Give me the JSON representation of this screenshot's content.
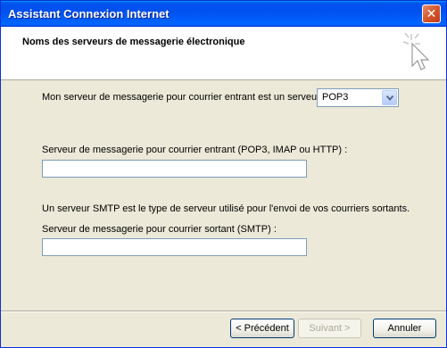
{
  "window": {
    "title": "Assistant Connexion Internet",
    "close_glyph": "✕"
  },
  "header": {
    "title": "Noms des serveurs de messagerie électronique",
    "icon": "wizard-wand-icon"
  },
  "incoming_type": {
    "label": "Mon serveur de messagerie pour courrier entrant est un serveur",
    "value": "POP3"
  },
  "incoming_server": {
    "label": "Serveur de messagerie pour courrier entrant (POP3, IMAP ou HTTP) :",
    "value": ""
  },
  "smtp_info": "Un serveur SMTP est le type de serveur utilisé pour l'envoi de vos courriers sortants.",
  "outgoing_server": {
    "label": "Serveur de messagerie pour courrier sortant (SMTP) :",
    "value": ""
  },
  "buttons": {
    "back": "< Précédent",
    "next": "Suivant >",
    "cancel": "Annuler"
  }
}
